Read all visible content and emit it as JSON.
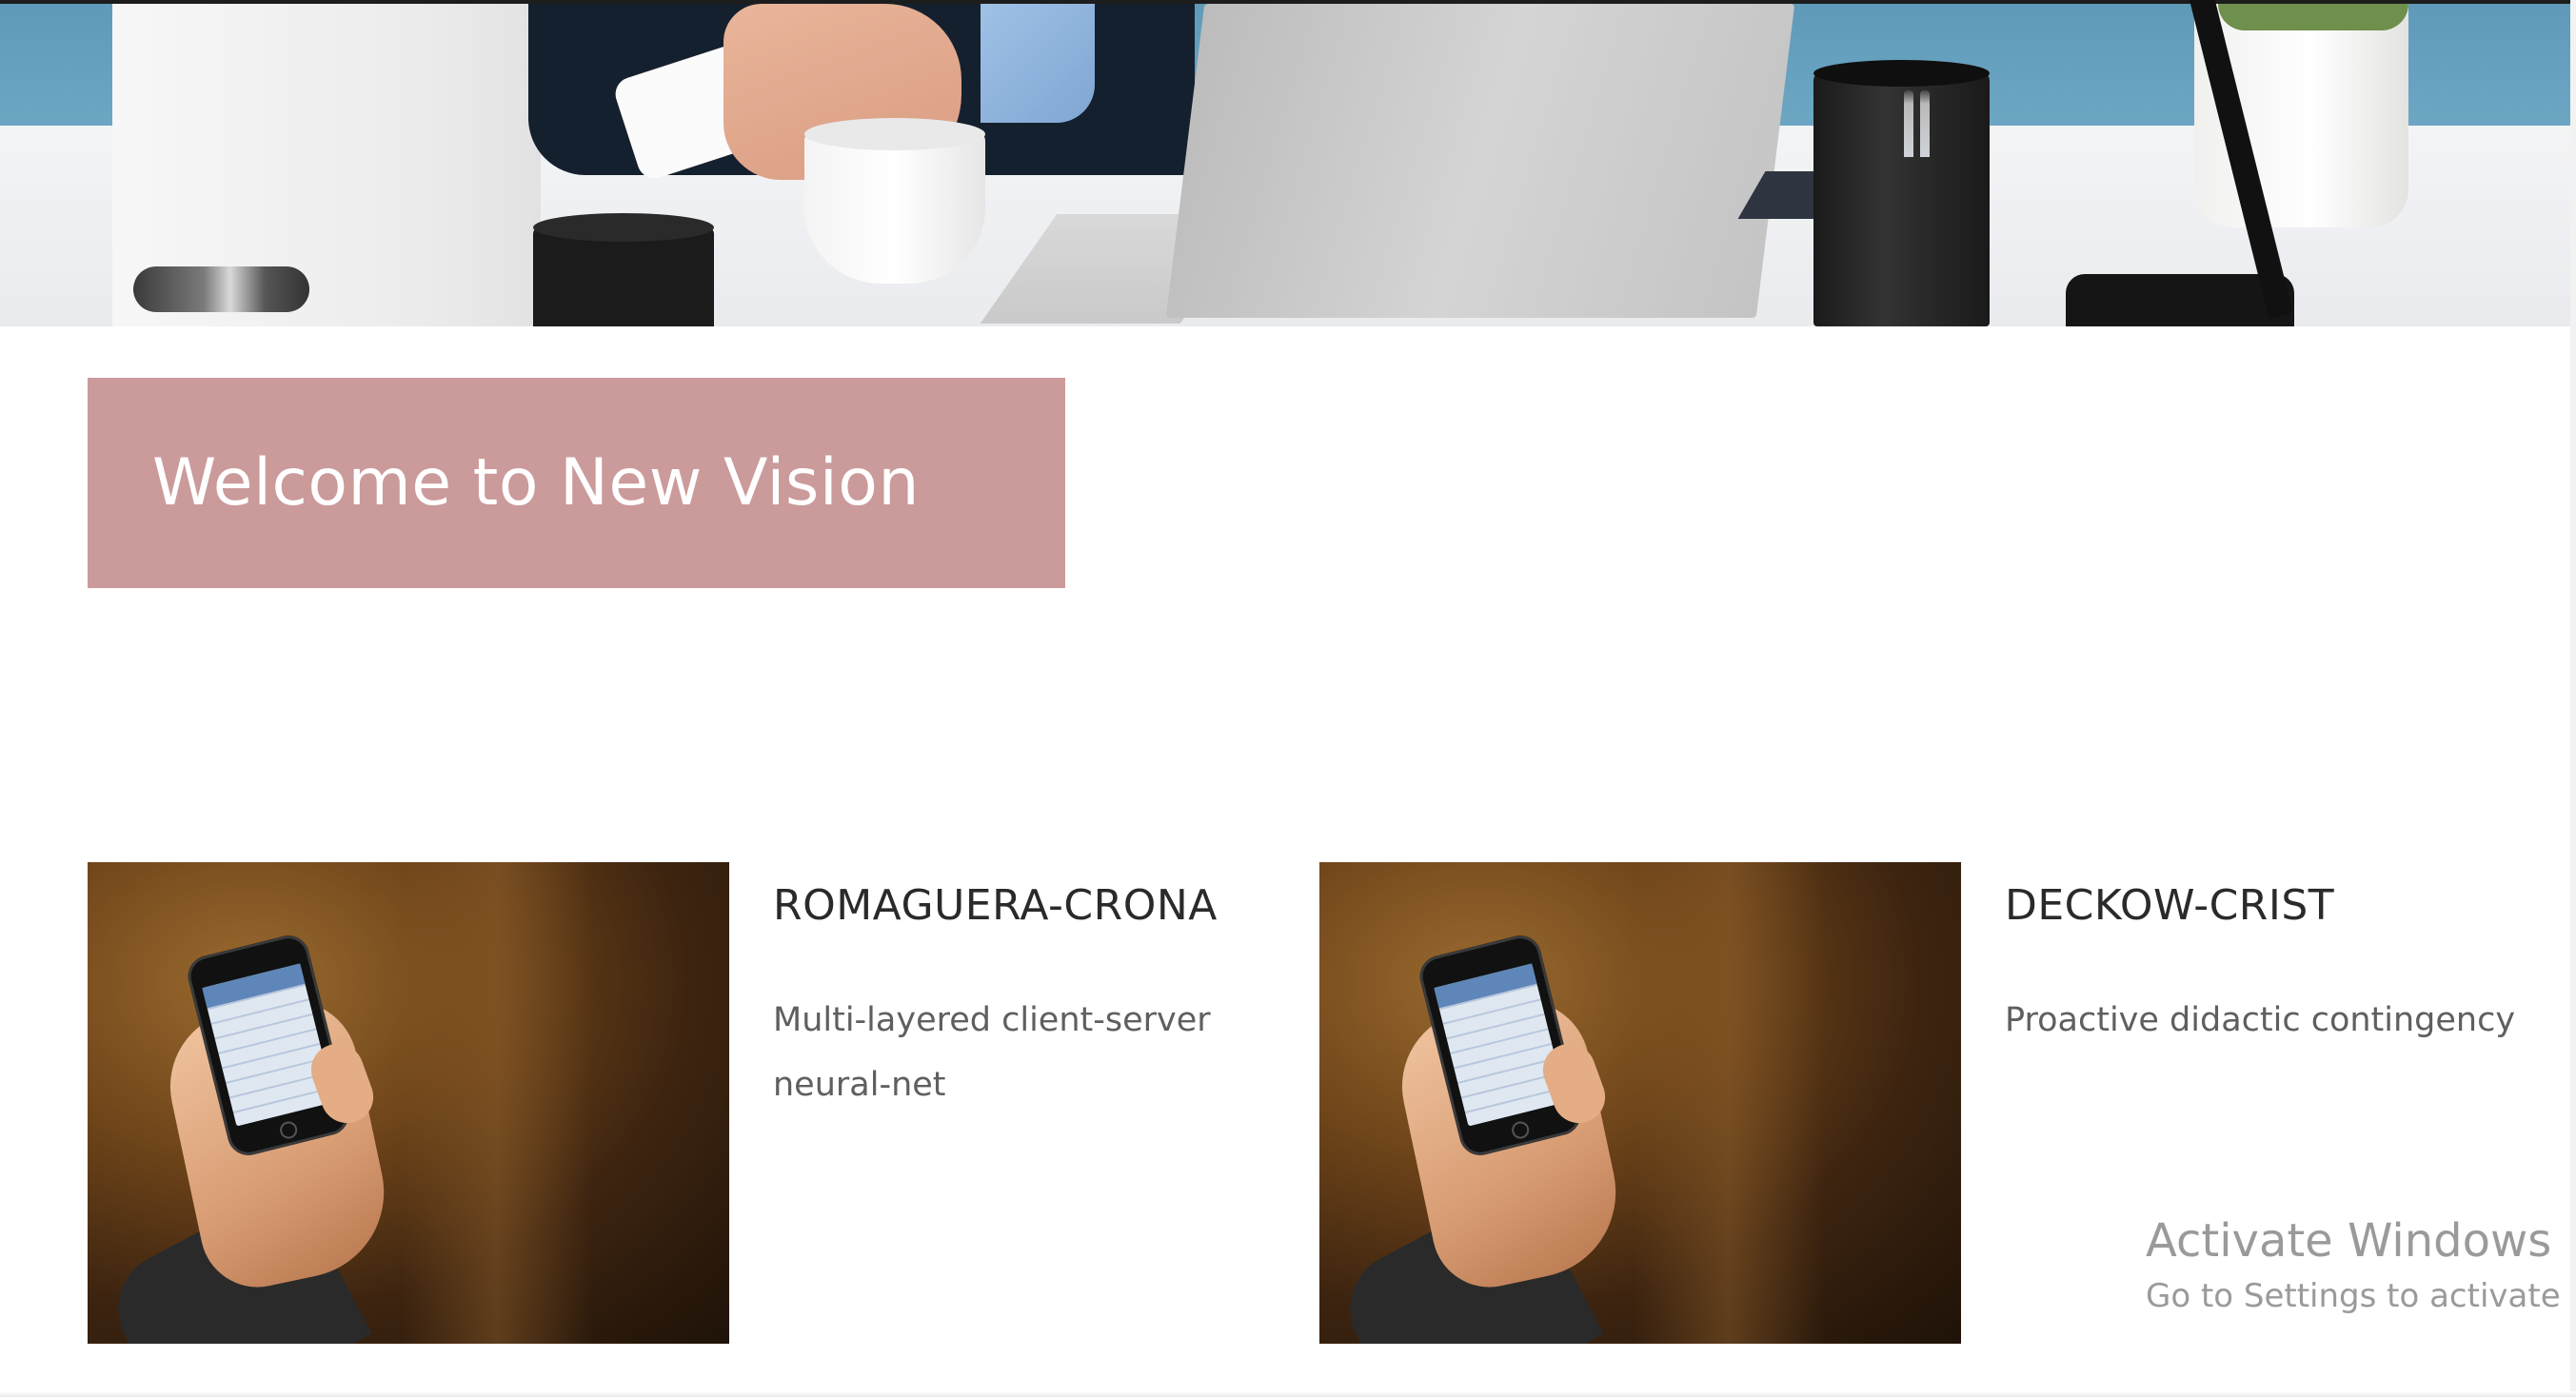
{
  "hero": {
    "image_alt": ""
  },
  "welcome": {
    "title": "Welcome to New Vision",
    "background_color": "#cb9a9b"
  },
  "cards": [
    {
      "title": "ROMAGUERA-CRONA",
      "description": "Multi-layered client-server neural-net"
    },
    {
      "title": "DECKOW-CRIST",
      "description": "Proactive didactic contingency"
    }
  ],
  "watermark": {
    "title": "Activate Windows",
    "subtitle": "Go to Settings to activate Windows."
  }
}
